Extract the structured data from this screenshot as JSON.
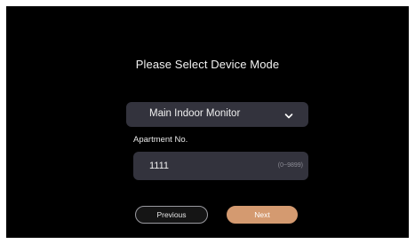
{
  "title": "Please Select Device Mode",
  "device_mode": {
    "selected": "Main Indoor Monitor",
    "dropdown_icon": "chevron-down-icon"
  },
  "apartment": {
    "label": "Apartment No.",
    "value": "1111",
    "hint": "(0~9899)"
  },
  "buttons": {
    "previous": "Previous",
    "next": "Next"
  },
  "colors": {
    "background": "#000000",
    "field": "#33333d",
    "accent": "#d49a70"
  }
}
